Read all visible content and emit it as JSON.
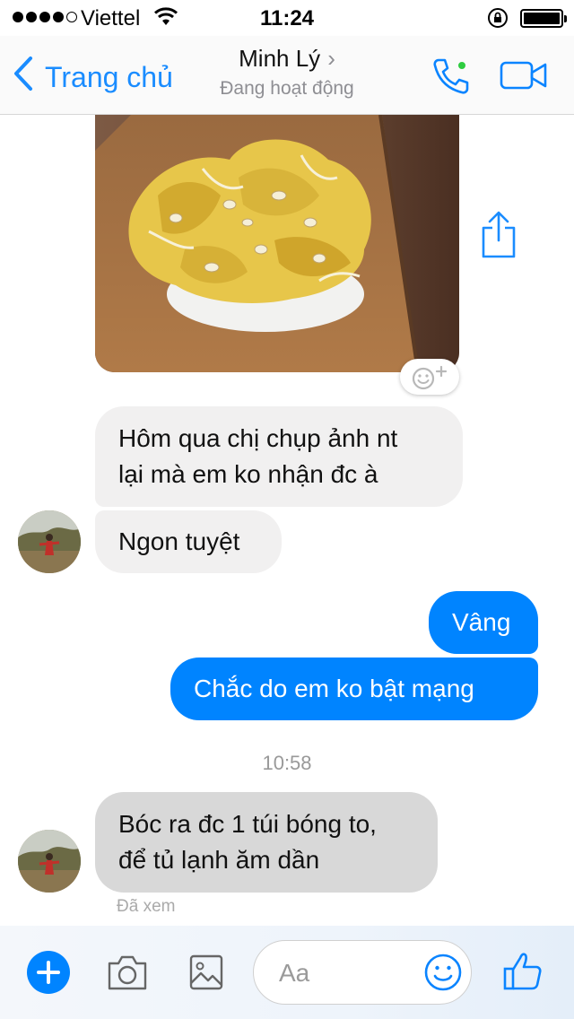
{
  "status_bar": {
    "carrier": "Viettel",
    "time": "11:24"
  },
  "header": {
    "back_label": "Trang chủ",
    "contact_name": "Minh Lý",
    "contact_status": "Đang hoạt động",
    "online": true
  },
  "messages": [
    {
      "direction": "incoming",
      "text_lines": [
        "Hôm qua chị chụp ảnh nt",
        "lại mà em ko nhận đc à"
      ]
    },
    {
      "direction": "incoming",
      "text": "Ngon tuyệt"
    },
    {
      "direction": "outgoing",
      "text": "Vâng"
    },
    {
      "direction": "outgoing",
      "text": "Chắc do em ko bật mạng"
    },
    {
      "direction": "incoming",
      "text_lines": [
        "Bóc ra đc 1 túi bóng to,",
        "để tủ lạnh ăm dần"
      ]
    }
  ],
  "timestamp": "10:58",
  "seen_label": "Đã xem",
  "composer": {
    "placeholder": "Aa"
  },
  "colors": {
    "accent": "#0084ff",
    "incoming_bubble": "#f1f0f0",
    "online": "#2ecc40"
  },
  "icons": [
    "wifi-icon",
    "lock-rotation-icon",
    "battery-icon",
    "back-chevron-icon",
    "phone-icon",
    "video-icon",
    "share-icon",
    "reaction-icon",
    "plus-icon",
    "camera-icon",
    "gallery-icon",
    "emoji-icon",
    "thumbs-up-icon"
  ]
}
